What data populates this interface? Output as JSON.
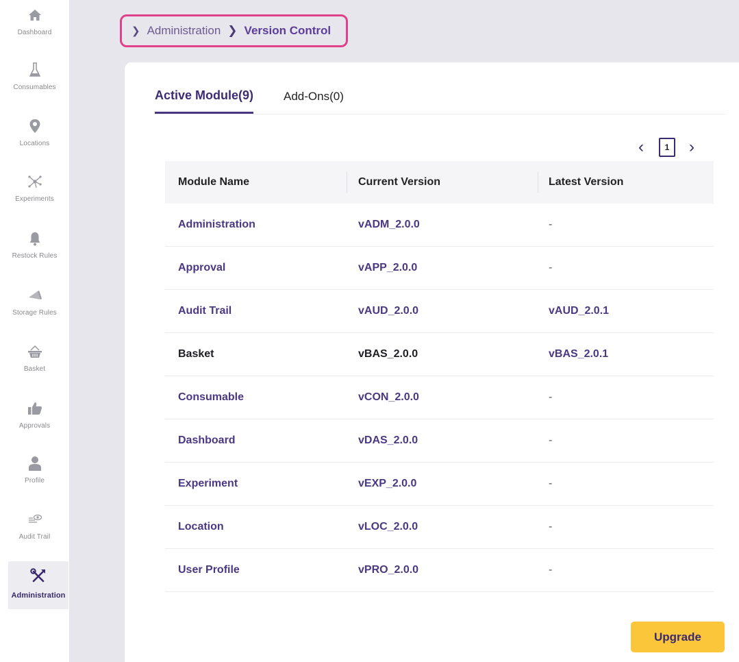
{
  "sidebar": {
    "items": [
      {
        "label": "Dashboard",
        "icon": "home-icon"
      },
      {
        "label": "Consumables",
        "icon": "flask-icon"
      },
      {
        "label": "Locations",
        "icon": "location-pin-icon"
      },
      {
        "label": "Experiments",
        "icon": "molecule-icon"
      },
      {
        "label": "Restock Rules",
        "icon": "bell-icon"
      },
      {
        "label": "Storage Rules",
        "icon": "megaphone-icon"
      },
      {
        "label": "Basket",
        "icon": "basket-icon"
      },
      {
        "label": "Approvals",
        "icon": "thumbs-up-icon"
      },
      {
        "label": "Profile",
        "icon": "user-icon"
      },
      {
        "label": "Audit Trail",
        "icon": "audit-eye-icon"
      },
      {
        "label": "Administration",
        "icon": "tools-icon",
        "active": true
      }
    ]
  },
  "breadcrumb": {
    "parent": "Administration",
    "current": "Version Control"
  },
  "tabs": {
    "active": "Active Module(9)",
    "inactive": "Add-Ons(0)"
  },
  "pagination": {
    "page": "1"
  },
  "table": {
    "headers": [
      "Module Name",
      "Current Version",
      "Latest Version"
    ],
    "rows": [
      {
        "name": "Administration",
        "current": "vADM_2.0.0",
        "latest": "-"
      },
      {
        "name": "Approval",
        "current": "vAPP_2.0.0",
        "latest": "-"
      },
      {
        "name": "Audit Trail",
        "current": "vAUD_2.0.0",
        "latest": "vAUD_2.0.1"
      },
      {
        "name": "Basket",
        "current": "vBAS_2.0.0",
        "latest": "vBAS_2.0.1"
      },
      {
        "name": "Consumable",
        "current": "vCON_2.0.0",
        "latest": "-"
      },
      {
        "name": "Dashboard",
        "current": "vDAS_2.0.0",
        "latest": "-"
      },
      {
        "name": "Experiment",
        "current": "vEXP_2.0.0",
        "latest": "-"
      },
      {
        "name": "Location",
        "current": "vLOC_2.0.0",
        "latest": "-"
      },
      {
        "name": "User Profile",
        "current": "vPRO_2.0.0",
        "latest": "-"
      }
    ]
  },
  "actions": {
    "upgrade_label": "Upgrade"
  },
  "colors": {
    "primary": "#4a3882",
    "highlight_border": "#e0418a",
    "upgrade_button": "#fcc63a",
    "background": "#e7e6ec"
  }
}
